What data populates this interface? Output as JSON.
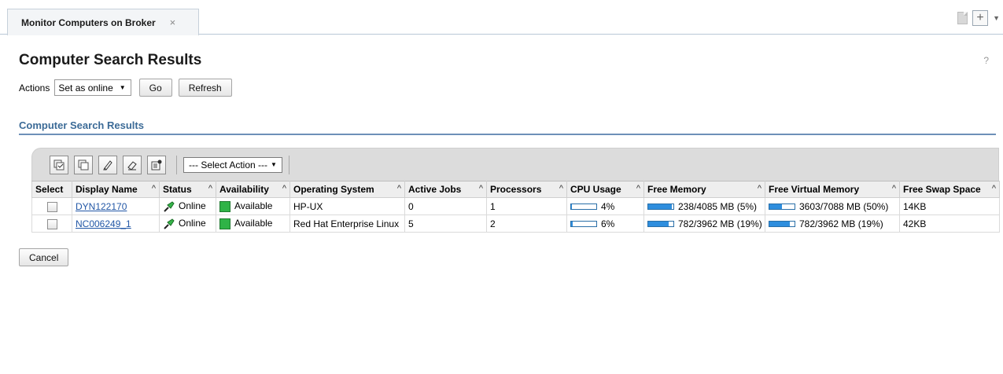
{
  "tab": {
    "label": "Monitor Computers on Broker",
    "close": "×"
  },
  "header": {
    "title": "Computer Search Results",
    "help": "?"
  },
  "actions": {
    "label": "Actions",
    "selected": "Set as online",
    "go": "Go",
    "refresh": "Refresh"
  },
  "section": {
    "title": "Computer Search Results"
  },
  "toolbar": {
    "select_action": "--- Select Action ---"
  },
  "columns": [
    "Select",
    "Display Name",
    "Status",
    "Availability",
    "Operating System",
    "Active Jobs",
    "Processors",
    "CPU Usage",
    "Free Memory",
    "Free Virtual Memory",
    "Free Swap Space"
  ],
  "rows": [
    {
      "name": "DYN122170",
      "status": "Online",
      "availability": "Available",
      "os": "HP-UX",
      "active_jobs": "0",
      "processors": "1",
      "cpu": "4%",
      "cpu_frac": 0.04,
      "mem": "238/4085 MB (5%)",
      "mem_frac": 0.95,
      "vmem": "3603/7088 MB (50%)",
      "vmem_frac": 0.5,
      "swap": "14KB"
    },
    {
      "name": "NC006249_1",
      "status": "Online",
      "availability": "Available",
      "os": "Red Hat Enterprise Linux",
      "active_jobs": "5",
      "processors": "2",
      "cpu": "6%",
      "cpu_frac": 0.06,
      "mem": "782/3962 MB (19%)",
      "mem_frac": 0.81,
      "vmem": "782/3962 MB (19%)",
      "vmem_frac": 0.81,
      "swap": "42KB"
    }
  ],
  "cancel": "Cancel",
  "colors": {
    "accent": "#3c6b97",
    "link": "#2257a6",
    "available": "#2fb347",
    "bar": "#2e8ede"
  }
}
